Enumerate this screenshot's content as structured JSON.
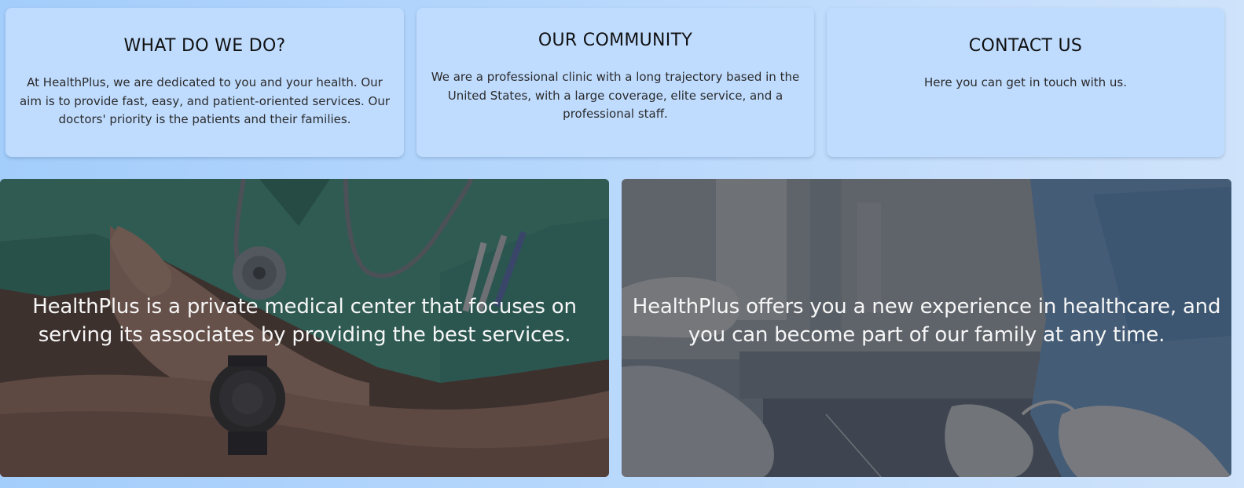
{
  "cards": {
    "what": {
      "title": "WHAT DO WE DO?",
      "text": "At HealthPlus, we are dedicated to you and your health. Our aim is to provide fast, easy, and patient-oriented services. Our doctors' priority is the patients and their families."
    },
    "community": {
      "title": "OUR COMMUNITY",
      "text": "We are a professional clinic with a long trajectory based in the United States, with a large coverage, elite service, and a professional staff."
    },
    "contact": {
      "title": "CONTACT US",
      "text": "Here you can get in touch with us."
    }
  },
  "banners": {
    "left": {
      "caption": "HealthPlus is a private medical center that focuses on serving its associates by providing the best services."
    },
    "right": {
      "caption": "HealthPlus offers you a new experience in healthcare, and you can become part of our family at any time."
    }
  },
  "colors": {
    "page_background": "#b8d8fc",
    "card_background": "#bfdcff",
    "caption_text": "#f6f6f6"
  }
}
